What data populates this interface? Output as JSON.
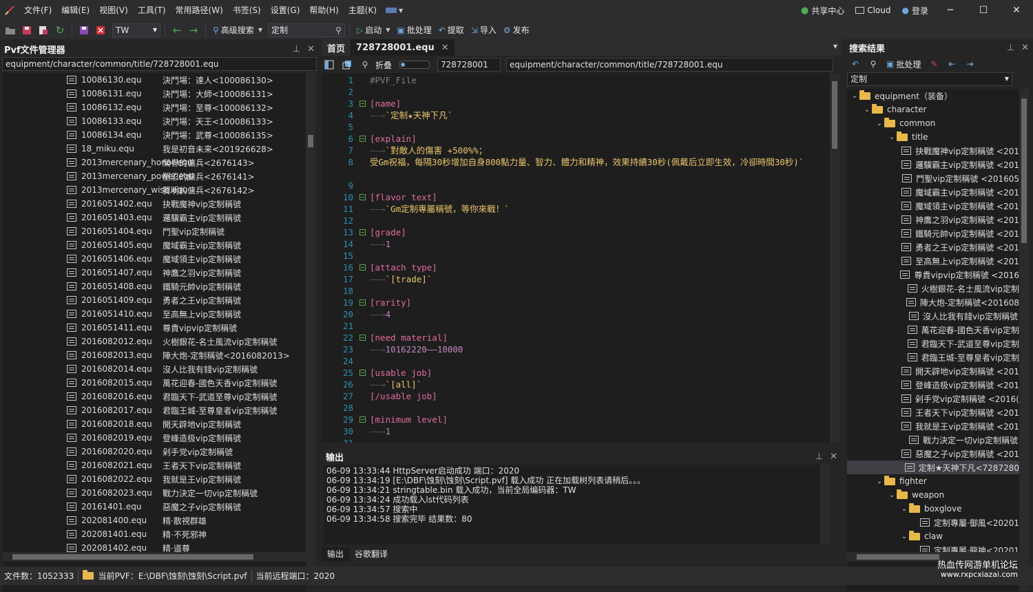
{
  "menubar": {
    "items": [
      "文件(F)",
      "编辑(E)",
      "视图(V)",
      "工具(T)",
      "常用路径(W)",
      "书签(S)",
      "设置(G)",
      "帮助(H)",
      "主题(K)"
    ],
    "share_center": "共享中心",
    "cloud": "Cloud",
    "login": "登录"
  },
  "toolbar": {
    "encoding": "TW",
    "advanced_search": "高级搜索",
    "search_value": "定制",
    "start": "启动",
    "batch": "批处理",
    "extract": "提取",
    "import": "导入",
    "publish": "发布"
  },
  "file_manager": {
    "title": "Pvf文件管理器",
    "path": "equipment/character/common/title/728728001.equ",
    "rows": [
      {
        "name": "10086130.equ",
        "desc": "決鬥場：達人<100086130>"
      },
      {
        "name": "10086131.equ",
        "desc": "決鬥場：大師<100086131>"
      },
      {
        "name": "10086132.equ",
        "desc": "決鬥場：至尊<100086132>"
      },
      {
        "name": "10086133.equ",
        "desc": "決鬥場：天王<100086133>"
      },
      {
        "name": "10086134.equ",
        "desc": "決鬥場：武尊<100086135>"
      },
      {
        "name": "18_miku.equ",
        "desc": "我是初音未来<201926628>"
      },
      {
        "name": "2013mercenary_honor.equ",
        "desc": "榮譽的傭兵<2676143>"
      },
      {
        "name": "2013mercenary_power.equ",
        "desc": "堅忍的傭兵<2676141>"
      },
      {
        "name": "2013mercenary_wise.equ",
        "desc": "賢明的傭兵<2676142>"
      },
      {
        "name": "2016051402.equ",
        "desc": "抉戰魔神vip定制稱號"
      },
      {
        "name": "2016051403.equ",
        "desc": "邏驥霸主vip定制稱號"
      },
      {
        "name": "2016051404.equ",
        "desc": "鬥聖vip定制稱號"
      },
      {
        "name": "2016051405.equ",
        "desc": "魔域霸主vip定制稱號"
      },
      {
        "name": "2016051406.equ",
        "desc": "魔域領主vip定制稱號"
      },
      {
        "name": "2016051407.equ",
        "desc": "神鷹之羽vip定制稱號"
      },
      {
        "name": "2016051408.equ",
        "desc": "鐵騎元帥vip定制稱號"
      },
      {
        "name": "2016051409.equ",
        "desc": "勇者之王vip定制稱號"
      },
      {
        "name": "2016051410.equ",
        "desc": "至高無上vip定制稱號"
      },
      {
        "name": "2016051411.equ",
        "desc": "尊貴vipvip定制稱號"
      },
      {
        "name": "2016082012.equ",
        "desc": "火樹銀花-名士風流vip定制稱號"
      },
      {
        "name": "2016082013.equ",
        "desc": "陣大炮-定制稱號<2016082013>"
      },
      {
        "name": "2016082014.equ",
        "desc": "沒人比我有錢vip定制稱號"
      },
      {
        "name": "2016082015.equ",
        "desc": "萬花迎春-國色天香vip定制稱號"
      },
      {
        "name": "2016082016.equ",
        "desc": "君臨天下-武道至尊vip定制稱號"
      },
      {
        "name": "2016082017.equ",
        "desc": "君臨王城-至尊皇者vip定制稱號"
      },
      {
        "name": "2016082018.equ",
        "desc": "開天辟地vip定制稱號"
      },
      {
        "name": "2016082019.equ",
        "desc": "登峰造极vip定制稱號"
      },
      {
        "name": "2016082020.equ",
        "desc": "剁手党vip定制稱號"
      },
      {
        "name": "2016082021.equ",
        "desc": "王者天下vip定制稱號"
      },
      {
        "name": "2016082022.equ",
        "desc": "我就是王vip定制稱號"
      },
      {
        "name": "2016082023.equ",
        "desc": "戰力決定一切vip定制稱號"
      },
      {
        "name": "20161401.equ",
        "desc": "惡魔之子vip定制稱號"
      },
      {
        "name": "202081400.equ",
        "desc": "精·散視群雄"
      },
      {
        "name": "202081401.equ",
        "desc": "精·不死邪神"
      },
      {
        "name": "202081402.equ",
        "desc": "精·道尊"
      }
    ]
  },
  "editor": {
    "tabs": [
      "首页",
      "728728001.equ"
    ],
    "fold_label": "折叠",
    "id_value": "728728001",
    "path_value": "equipment/character/common/title/728728001.equ",
    "lines": [
      {
        "n": "1",
        "k": "cmt",
        "t": "#PVF_File"
      },
      {
        "n": "2",
        "k": "plain",
        "t": ""
      },
      {
        "n": "3",
        "k": "sec",
        "t": "[name]",
        "fold": true
      },
      {
        "n": "4",
        "k": "str",
        "t": "`定制★天神下凡`",
        "arrow": true
      },
      {
        "n": "5",
        "k": "plain",
        "t": ""
      },
      {
        "n": "6",
        "k": "sec",
        "t": "[explain]",
        "fold": true
      },
      {
        "n": "7",
        "k": "str",
        "t": "`對敵人的傷害 +500%%；",
        "arrow": true
      },
      {
        "n": "8",
        "k": "str",
        "t": "受Gm祝福，每隔30秒增加自身800點力量、智力、體力和精神，效果持續30秒(佩戴后立即生效，冷卻時間30秒)`",
        "wrap": true
      },
      {
        "n": "9",
        "k": "plain",
        "t": ""
      },
      {
        "n": "10",
        "k": "sec",
        "t": "[flavor text]",
        "fold": true
      },
      {
        "n": "11",
        "k": "str",
        "t": "`Gm定制專屬稱號，等你來戰！`",
        "arrow": true
      },
      {
        "n": "12",
        "k": "plain",
        "t": ""
      },
      {
        "n": "13",
        "k": "sec",
        "t": "[grade]",
        "fold": true
      },
      {
        "n": "14",
        "k": "num",
        "t": "1",
        "arrow": true
      },
      {
        "n": "15",
        "k": "plain",
        "t": ""
      },
      {
        "n": "16",
        "k": "sec",
        "t": "[attach type]",
        "fold": true
      },
      {
        "n": "17",
        "k": "str",
        "t": "`[trade]`",
        "arrow": true
      },
      {
        "n": "18",
        "k": "plain",
        "t": ""
      },
      {
        "n": "19",
        "k": "sec",
        "t": "[rarity]",
        "fold": true
      },
      {
        "n": "20",
        "k": "num",
        "t": "4",
        "arrow": true
      },
      {
        "n": "21",
        "k": "plain",
        "t": ""
      },
      {
        "n": "22",
        "k": "sec",
        "t": "[need material]",
        "fold": true
      },
      {
        "n": "23",
        "k": "num",
        "t": "10162220——10000",
        "arrow": true
      },
      {
        "n": "24",
        "k": "plain",
        "t": ""
      },
      {
        "n": "25",
        "k": "sec",
        "t": "[usable job]",
        "fold": true
      },
      {
        "n": "26",
        "k": "str",
        "t": "`[all]`",
        "arrow": true
      },
      {
        "n": "27",
        "k": "sec",
        "t": "[/usable job]"
      },
      {
        "n": "28",
        "k": "plain",
        "t": ""
      },
      {
        "n": "29",
        "k": "sec",
        "t": "[minimum level]",
        "fold": true
      },
      {
        "n": "30",
        "k": "num",
        "t": "1",
        "arrow": true
      },
      {
        "n": "31",
        "k": "plain",
        "t": ""
      }
    ]
  },
  "output": {
    "title": "输出",
    "lines": [
      "06-09 13:33:44 HttpServer启动成功 端口：2020",
      "06-09 13:34:19 [E:\\DBF\\蚀刻\\蚀刻\\Script.pvf] 载入成功 正在加载树列表请稍后。。。",
      "06-09 13:34:21 stringtable.bin 载入成功，当前全局编码器：TW",
      "06-09 13:34:24 成功载入lst代码列表",
      "06-09 13:34:57 搜索中",
      "06-09 13:34:58 搜索完毕 结果数：80"
    ],
    "tabs": [
      "输出",
      "谷歌翻译"
    ]
  },
  "search": {
    "title": "搜索结果",
    "batch": "批处理",
    "filter_value": "定制",
    "tree": [
      {
        "lvl": 0,
        "type": "folder",
        "label": "equipment（装备）"
      },
      {
        "lvl": 1,
        "type": "folder",
        "label": "character"
      },
      {
        "lvl": 2,
        "type": "folder",
        "label": "common"
      },
      {
        "lvl": 3,
        "type": "folder",
        "label": "title"
      },
      {
        "lvl": 4,
        "type": "file",
        "label": "抉戰魔神vip定制稱號 <201"
      },
      {
        "lvl": 4,
        "type": "file",
        "label": "邏驥霸主vip定制稱號 <201"
      },
      {
        "lvl": 4,
        "type": "file",
        "label": "鬥聖vip定制稱號 <201605"
      },
      {
        "lvl": 4,
        "type": "file",
        "label": "魔域霸主vip定制稱號 <201"
      },
      {
        "lvl": 4,
        "type": "file",
        "label": "魔域領主vip定制稱號 <201"
      },
      {
        "lvl": 4,
        "type": "file",
        "label": "神鷹之羽vip定制稱號 <201"
      },
      {
        "lvl": 4,
        "type": "file",
        "label": "鐵騎元帥vip定制稱號 <201"
      },
      {
        "lvl": 4,
        "type": "file",
        "label": "勇者之王vip定制稱號 <201"
      },
      {
        "lvl": 4,
        "type": "file",
        "label": "至高無上vip定制稱號 <201"
      },
      {
        "lvl": 4,
        "type": "file",
        "label": "尊貴vipvip定制稱號 <2016"
      },
      {
        "lvl": 4,
        "type": "file",
        "label": "火樹銀花-名士風流vip定制"
      },
      {
        "lvl": 4,
        "type": "file",
        "label": "陣大炮-定制稱號<201608"
      },
      {
        "lvl": 4,
        "type": "file",
        "label": "沒人比我有錢vip定制稱號"
      },
      {
        "lvl": 4,
        "type": "file",
        "label": "萬花迎春-國色天香vip定制"
      },
      {
        "lvl": 4,
        "type": "file",
        "label": "君臨天下-武道至尊vip定制"
      },
      {
        "lvl": 4,
        "type": "file",
        "label": "君臨王城-至尊皇者vip定制"
      },
      {
        "lvl": 4,
        "type": "file",
        "label": "開天辟地vip定制稱號 <201"
      },
      {
        "lvl": 4,
        "type": "file",
        "label": "登峰造极vip定制稱號 <201"
      },
      {
        "lvl": 4,
        "type": "file",
        "label": "剁手党vip定制稱號 <2016("
      },
      {
        "lvl": 4,
        "type": "file",
        "label": "王者天下vip定制稱號 <201"
      },
      {
        "lvl": 4,
        "type": "file",
        "label": "我就是王vip定制稱號 <201"
      },
      {
        "lvl": 4,
        "type": "file",
        "label": "戰力決定一切vip定制稱號"
      },
      {
        "lvl": 4,
        "type": "file",
        "label": "惡魔之子vip定制稱號 <201"
      },
      {
        "lvl": 4,
        "type": "file",
        "label": "定制★天神下凡<7287280",
        "selected": true
      },
      {
        "lvl": 2,
        "type": "folder",
        "label": "fighter"
      },
      {
        "lvl": 3,
        "type": "folder",
        "label": "weapon"
      },
      {
        "lvl": 4,
        "type": "folder",
        "label": "boxglove"
      },
      {
        "lvl": 5,
        "type": "file",
        "label": "定制專屬·御風<20201"
      },
      {
        "lvl": 4,
        "type": "folder",
        "label": "claw"
      },
      {
        "lvl": 5,
        "type": "file",
        "label": "定制專屬·龍神<20201"
      }
    ]
  },
  "statusbar": {
    "file_count": "文件数：1052333",
    "current_pvf": "当前PVF：E:\\DBF\\蚀刻\\蚀刻\\Script.pvf",
    "remote_port": "当前远程端口：2020",
    "watermark": "热血传网游单机论坛",
    "watermark_url": "www.rxpcxiazai.com"
  },
  "colors": {
    "accent": "#007acc",
    "section": "#e06c9f",
    "string": "#e8c46a",
    "number": "#c586c0",
    "linenum": "#2b91af"
  }
}
